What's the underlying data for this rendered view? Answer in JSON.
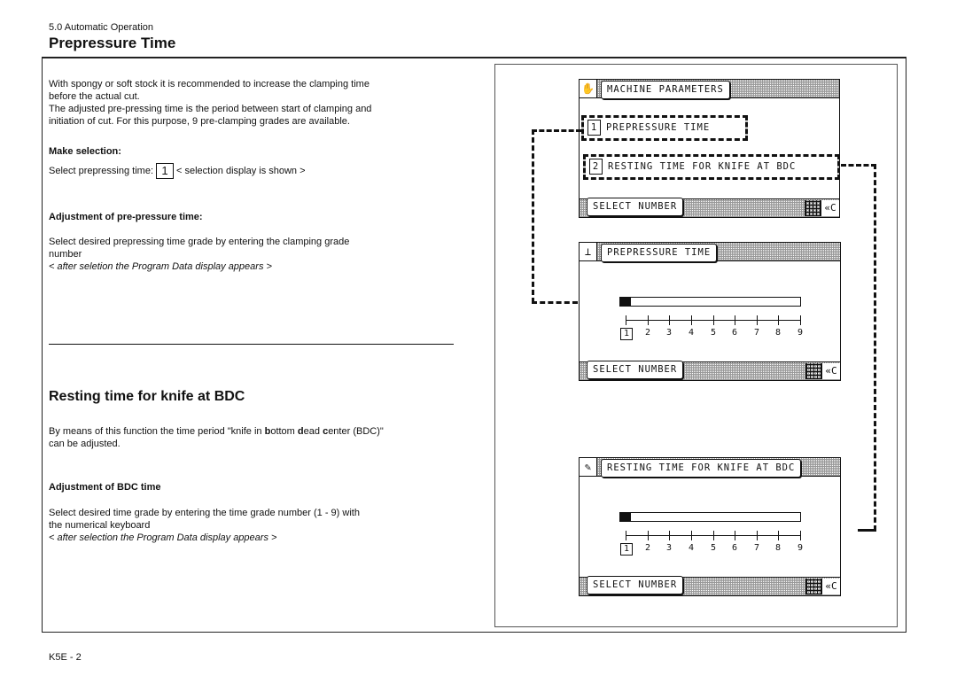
{
  "header": {
    "section": "5.0 Automatic Operation",
    "title": "Prepressure Time"
  },
  "prepressure": {
    "intro_1": "With spongy or soft stock it is recommended to increase the clamping time",
    "intro_2": "before the actual cut.",
    "intro_3": "The adjusted pre-pressing time is the period between start of clamping and",
    "intro_4": "initiation of cut. For this purpose, 9 pre-clamping grades are available.",
    "make_selection_heading": "Make selection:",
    "select_prefix": "Select prepressing time:",
    "select_key": "1",
    "select_suffix": "< selection display is shown >",
    "adjust_heading": "Adjustment of pre-pressure time:",
    "adjust_1": "Select desired prepressing time grade by entering the clamping grade",
    "adjust_2": "number",
    "adjust_note": "< after seletion the Program Data display appears >"
  },
  "bdc": {
    "title": "Resting time for knife at BDC",
    "desc_1a": "By means of this function the time period \"knife in ",
    "desc_b": "b",
    "desc_1b": "ottom ",
    "desc_d": "d",
    "desc_1c": "ead ",
    "desc_c": "c",
    "desc_1d": "enter (BDC)\"",
    "desc_2": "can be adjusted.",
    "adjust_heading": "Adjustment of BDC time",
    "adjust_1": "Select desired time grade by entering the time grade number (1 - 9) with",
    "adjust_2": "the numerical keyboard",
    "adjust_note": "< after selection the Program Data display appears >"
  },
  "screens": {
    "machine_parameters": {
      "title": "MACHINE PARAMETERS",
      "icon": "hand-knife-icon",
      "options": [
        {
          "num": "1",
          "label": "PREPRESSURE TIME"
        },
        {
          "num": "2",
          "label": "RESTING TIME FOR KNIFE AT BDC"
        }
      ],
      "footer": "SELECT NUMBER",
      "clear": "«C"
    },
    "prepressure_time": {
      "title": "PREPRESSURE TIME",
      "icon": "clamp-icon",
      "level": 1,
      "max": 9,
      "scale": [
        "1",
        "2",
        "3",
        "4",
        "5",
        "6",
        "7",
        "8",
        "9"
      ],
      "footer": "SELECT NUMBER",
      "clear": "«C"
    },
    "resting_time": {
      "title": "RESTING TIME FOR KNIFE AT BDC",
      "icon": "knife-icon",
      "level": 1,
      "max": 9,
      "scale": [
        "1",
        "2",
        "3",
        "4",
        "5",
        "6",
        "7",
        "8",
        "9"
      ],
      "footer": "SELECT NUMBER",
      "clear": "«C"
    }
  },
  "footer": {
    "page_number": "K5E - 2"
  }
}
